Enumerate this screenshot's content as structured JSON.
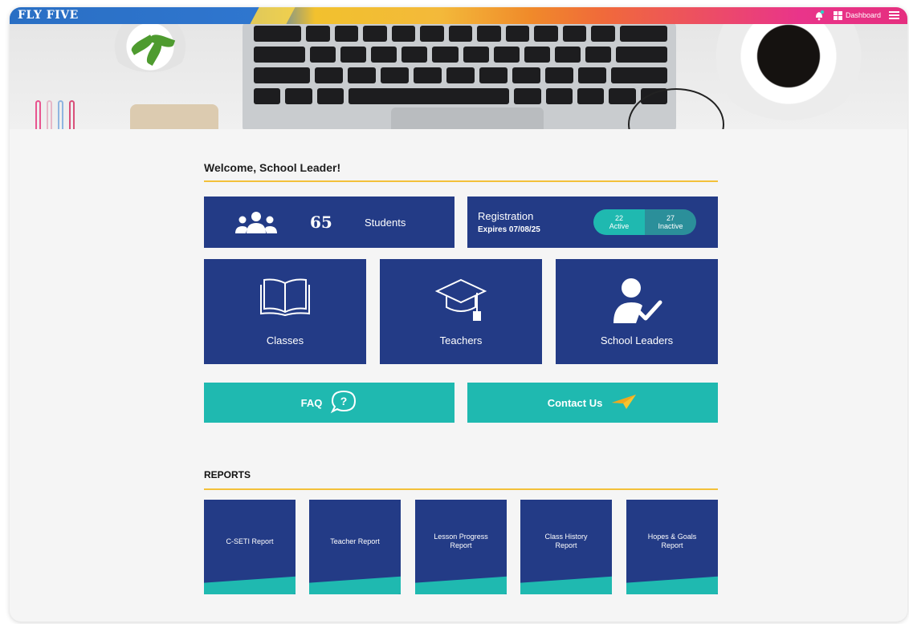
{
  "topbar": {
    "logo": "FLY FIVE",
    "dashboard_label": "Dashboard"
  },
  "welcome": "Welcome, School Leader!",
  "students": {
    "count": "65",
    "label": "Students"
  },
  "registration": {
    "title": "Registration",
    "expires": "Expires 07/08/25",
    "active_count": "22",
    "active_label": "Active",
    "inactive_count": "27",
    "inactive_label": "Inactive"
  },
  "tiles": {
    "classes": "Classes",
    "teachers": "Teachers",
    "school_leaders": "School Leaders"
  },
  "faq": "FAQ",
  "contact": "Contact Us",
  "reports": {
    "title": "REPORTS",
    "items": [
      {
        "label": "C-SETI Report"
      },
      {
        "label": "Teacher Report"
      },
      {
        "label": "Lesson Progress Report"
      },
      {
        "label": "Class History Report"
      },
      {
        "label": "Hopes & Goals Report"
      }
    ]
  },
  "colors": {
    "navy": "#233b86",
    "teal": "#1fb9b0",
    "accent_yellow": "#f3c13a"
  }
}
